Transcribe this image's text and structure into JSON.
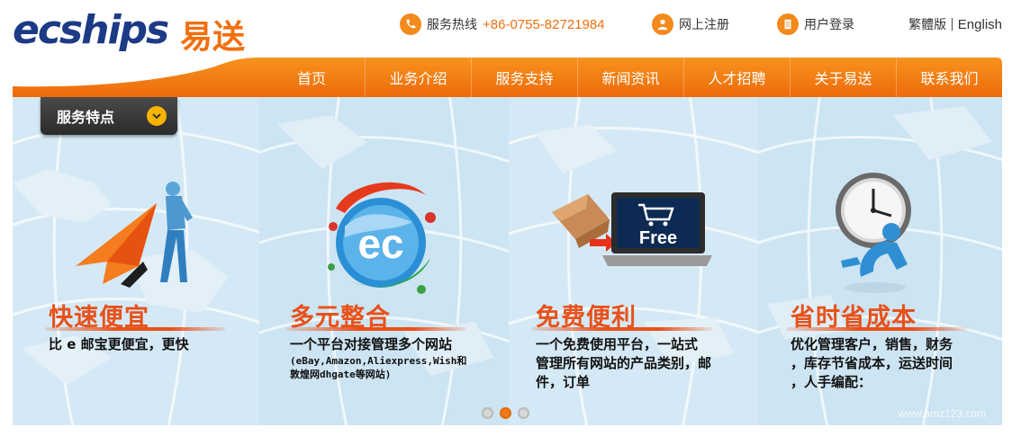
{
  "logo": {
    "latin": "ecships",
    "cn": "易送"
  },
  "header": {
    "hotline_label": "服务热线",
    "hotline_number": "+86-0755-82721984",
    "register": "网上注册",
    "login": "用户登录",
    "lang_trad": "繁體版",
    "lang_sep": "|",
    "lang_en": "English"
  },
  "nav": {
    "items": [
      "首页",
      "业务介绍",
      "服务支持",
      "新闻资讯",
      "人才招聘",
      "关于易送",
      "联系我们"
    ]
  },
  "banner": {
    "tag": "服务特点",
    "panels": [
      {
        "title": "快速便宜",
        "lines": [
          "比 e 邮宝更便宜，更快"
        ]
      },
      {
        "title": "多元整合",
        "lines": [
          "一个平台对接管理多个网站"
        ],
        "small_lines": [
          "(eBay,Amazon,Aliexpress,Wish和",
          "敦煌网dhgate等网站)"
        ],
        "icon_text": "ec"
      },
      {
        "title": "免费便利",
        "lines": [
          "一个免费使用平台，一站式",
          "管理所有网站的产品类别，邮",
          "件，订单"
        ],
        "icon_text": "Free"
      },
      {
        "title": "省时省成本",
        "lines": [
          "优化管理客户，销售，财务",
          "，库存节省成本，运送时间",
          "，人手编配："
        ]
      }
    ],
    "carousel": {
      "total": 3,
      "active": 2
    },
    "watermark": "www.amz123.com"
  },
  "colors": {
    "brand_orange": "#f07a19",
    "brand_blue": "#1c3a86",
    "heading_red": "#e8511a"
  },
  "icons": [
    "phone-icon",
    "user-icon",
    "document-icon",
    "chevron-down-icon"
  ]
}
